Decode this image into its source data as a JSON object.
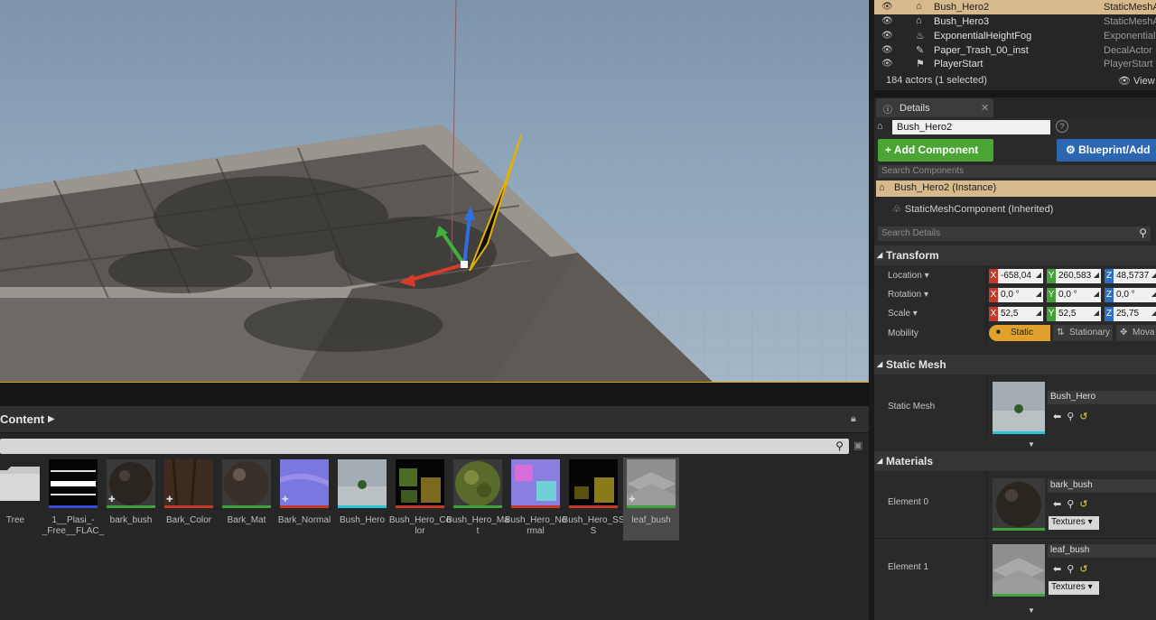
{
  "outliner": {
    "rows": [
      {
        "name": "Bush_Hero2",
        "type": "StaticMeshA",
        "selected": true
      },
      {
        "name": "Bush_Hero3",
        "type": "StaticMeshA"
      },
      {
        "name": "ExponentialHeightFog",
        "type": "ExponentialH"
      },
      {
        "name": "Paper_Trash_00_inst",
        "type": "DecalActor"
      },
      {
        "name": "PlayerStart",
        "type": "PlayerStart"
      }
    ],
    "actor_count": "184 actors (1 selected)",
    "view_options": "View"
  },
  "details": {
    "tab_label": "Details",
    "actor_name": "Bush_Hero2",
    "add_component": "+ Add Component",
    "blueprint": "Blueprint/Add",
    "search_components_placeholder": "Search Components",
    "instance_label": "Bush_Hero2 (Instance)",
    "component_label": "StaticMeshComponent (Inherited)",
    "search_details_placeholder": "Search Details"
  },
  "transform": {
    "category": "Transform",
    "location_label": "Location",
    "rotation_label": "Rotation",
    "scale_label": "Scale",
    "mobility_label": "Mobility",
    "location": {
      "x": "-658,04",
      "y": "260,583",
      "z": "48,5737"
    },
    "rotation": {
      "x": "0,0 °",
      "y": "0,0 °",
      "z": "0,0 °"
    },
    "scale": {
      "x": "52,5",
      "y": "52,5",
      "z": "25,75"
    },
    "mobility": {
      "static": "Static",
      "stationary": "Stationary",
      "movable": "Movable"
    }
  },
  "static_mesh": {
    "category": "Static Mesh",
    "label": "Static Mesh",
    "asset": "Bush_Hero"
  },
  "materials": {
    "category": "Materials",
    "elements": [
      {
        "label": "Element 0",
        "asset": "bark_bush",
        "dropdown": "Textures"
      },
      {
        "label": "Element 1",
        "asset": "leaf_bush",
        "dropdown": "Textures"
      }
    ]
  },
  "content_browser": {
    "title": "Content",
    "assets": [
      {
        "label": "Tree",
        "kind": "folder"
      },
      {
        "label": "1__Plasi_-_Free__FLAC_",
        "kind": "sound"
      },
      {
        "label": "bark_bush",
        "kind": "material"
      },
      {
        "label": "Bark_Color",
        "kind": "texture"
      },
      {
        "label": "Bark_Mat",
        "kind": "material"
      },
      {
        "label": "Bark_Normal",
        "kind": "texture"
      },
      {
        "label": "Bush_Hero",
        "kind": "mesh"
      },
      {
        "label": "Bush_Hero_Color",
        "kind": "texture"
      },
      {
        "label": "Bush_Hero_Mat",
        "kind": "material"
      },
      {
        "label": "Bush_Hero_Normal",
        "kind": "texture"
      },
      {
        "label": "Bush_Hero_SSS",
        "kind": "texture"
      },
      {
        "label": "leaf_bush",
        "kind": "material",
        "selected": true
      }
    ]
  },
  "colors": {
    "selection": "#d7b98e",
    "viewport_border": "#d9a400",
    "add_component": "#4aa534",
    "blueprint": "#2b67b0"
  }
}
